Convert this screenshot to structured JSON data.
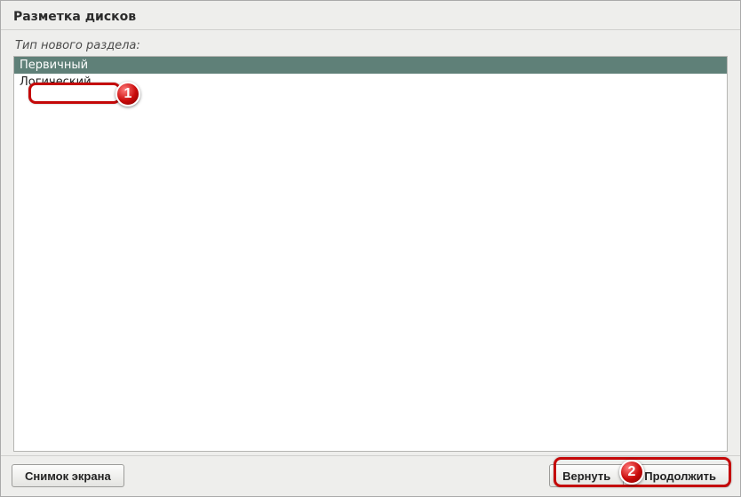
{
  "header": {
    "title": "Разметка дисков"
  },
  "content": {
    "prompt": "Тип нового раздела:",
    "options": [
      {
        "label": "Первичный",
        "selected": true
      },
      {
        "label": "Логический",
        "selected": false
      }
    ]
  },
  "footer": {
    "screenshot": "Снимок экрана",
    "back": "Вернуть",
    "continue": "Продолжить"
  },
  "callouts": {
    "badge1": "1",
    "badge2": "2"
  }
}
